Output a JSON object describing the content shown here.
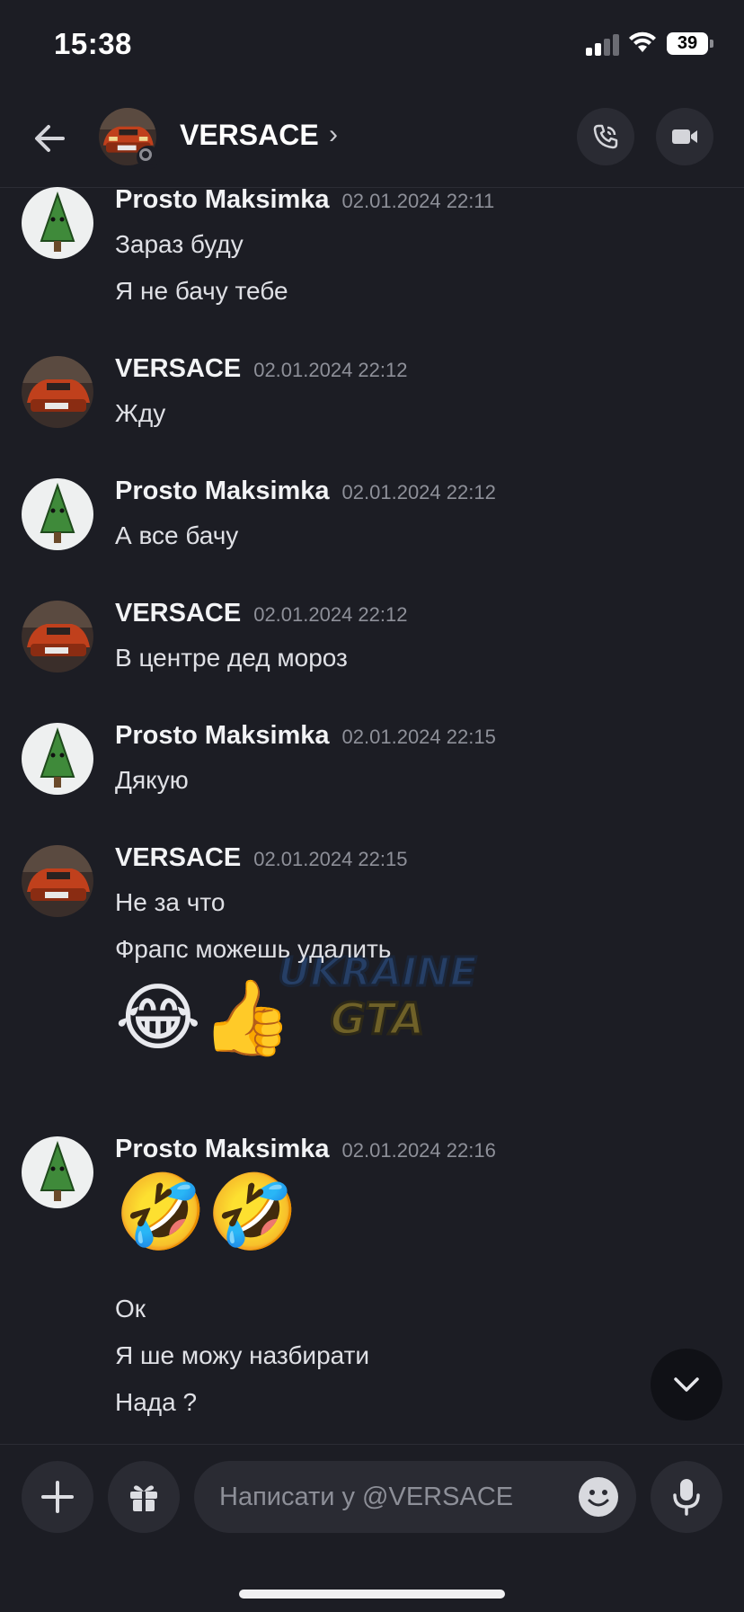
{
  "status_bar": {
    "time": "15:38",
    "battery": "39"
  },
  "header": {
    "name": "VERSACE",
    "chevron": "›"
  },
  "messages": [
    {
      "author": "Prosto Maksimka",
      "timestamp": "02.01.2024 22:11",
      "lines": [
        "Зараз буду",
        "Я не бачу тебе"
      ]
    },
    {
      "author": "VERSACE",
      "timestamp": "02.01.2024 22:12",
      "lines": [
        "Жду"
      ]
    },
    {
      "author": "Prosto Maksimka",
      "timestamp": "02.01.2024 22:12",
      "lines": [
        "А все бачу"
      ]
    },
    {
      "author": "VERSACE",
      "timestamp": "02.01.2024 22:12",
      "lines": [
        "В центре дед мороз"
      ]
    },
    {
      "author": "Prosto Maksimka",
      "timestamp": "02.01.2024 22:15",
      "lines": [
        "Дякую"
      ]
    },
    {
      "author": "VERSACE",
      "timestamp": "02.01.2024 22:15",
      "lines": [
        "Не за что",
        "Фрапс можешь удалить"
      ],
      "emoji": "😂👍"
    },
    {
      "author": "Prosto Maksimka",
      "timestamp": "02.01.2024 22:16",
      "emoji": "🤣🤣",
      "lines": [
        "Ок",
        "Я ше можу назбирати",
        "Нада ?"
      ]
    }
  ],
  "watermark": {
    "line1": "UKRAINE",
    "line2": "GTA"
  },
  "composer": {
    "placeholder": "Написати у @VERSACE"
  },
  "icons": {
    "back": "arrow-left-icon",
    "call": "phone-icon",
    "video": "video-camera-icon",
    "add": "plus-icon",
    "gift": "gift-icon",
    "emoji": "smiley-icon",
    "mic": "microphone-icon",
    "scroll": "chevron-down-icon"
  }
}
